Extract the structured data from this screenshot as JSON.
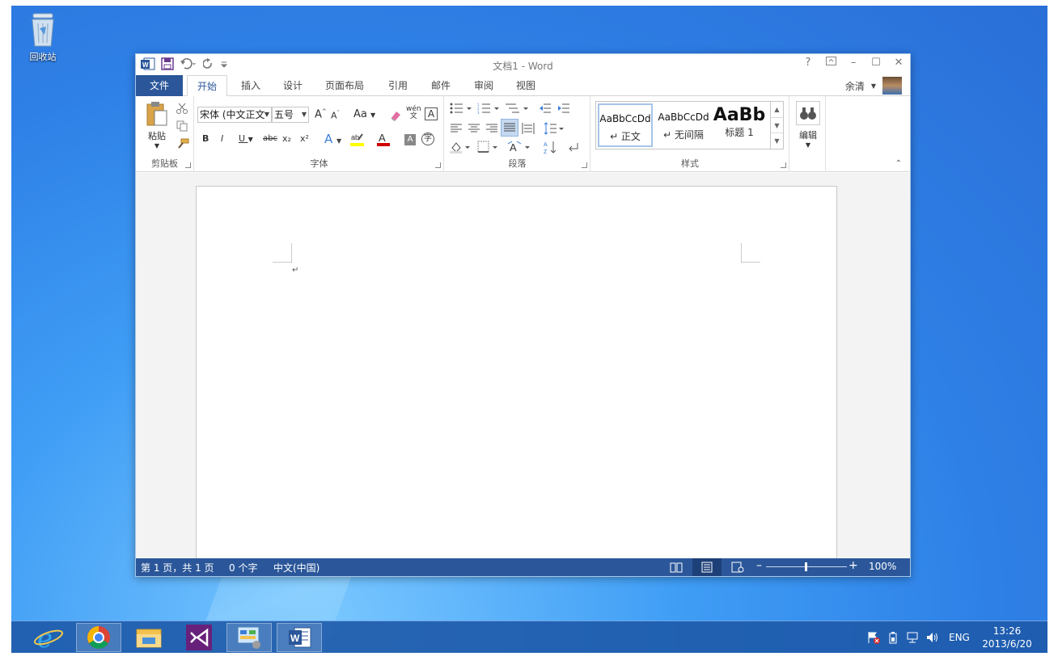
{
  "desktop": {
    "recycle_bin_label": "回收站"
  },
  "window": {
    "title": "文档1 - Word",
    "help": "?",
    "minimize": "–",
    "maximize": "☐",
    "close": "✕"
  },
  "tabs": {
    "file": "文件",
    "items": [
      "开始",
      "插入",
      "设计",
      "页面布局",
      "引用",
      "邮件",
      "审阅",
      "视图"
    ],
    "active": "开始",
    "user_name": "余清"
  },
  "ribbon": {
    "clipboard": {
      "paste": "粘贴",
      "label": "剪贴板"
    },
    "font": {
      "font_name": "宋体 (中文正文",
      "font_size": "五号",
      "case_button": "Aa",
      "bold": "B",
      "italic": "I",
      "underline": "U",
      "strikethrough": "abc",
      "subscript": "x₂",
      "superscript": "x²",
      "phonetic": "wén",
      "enclose_char": "字",
      "label": "字体"
    },
    "paragraph": {
      "label": "段落"
    },
    "styles": {
      "items": [
        {
          "sample": "AaBbCcDd",
          "name": "↵ 正文"
        },
        {
          "sample": "AaBbCcDd",
          "name": "↵ 无间隔"
        },
        {
          "sample": "AaBb",
          "name": "标题 1"
        }
      ],
      "label": "样式"
    },
    "editing": {
      "label": "编辑"
    }
  },
  "document": {
    "paragraph_mark": "↵"
  },
  "statusbar": {
    "page": "第 1 页，共 1 页",
    "words": "0 个字",
    "language": "中文(中国)",
    "zoom": "100%",
    "zoom_minus": "–",
    "zoom_plus": "+"
  },
  "taskbar": {
    "language": "ENG",
    "time": "13:26",
    "date": "2013/6/20"
  },
  "colors": {
    "word_blue": "#2b579a",
    "desktop_blue": "#2f86e8"
  }
}
